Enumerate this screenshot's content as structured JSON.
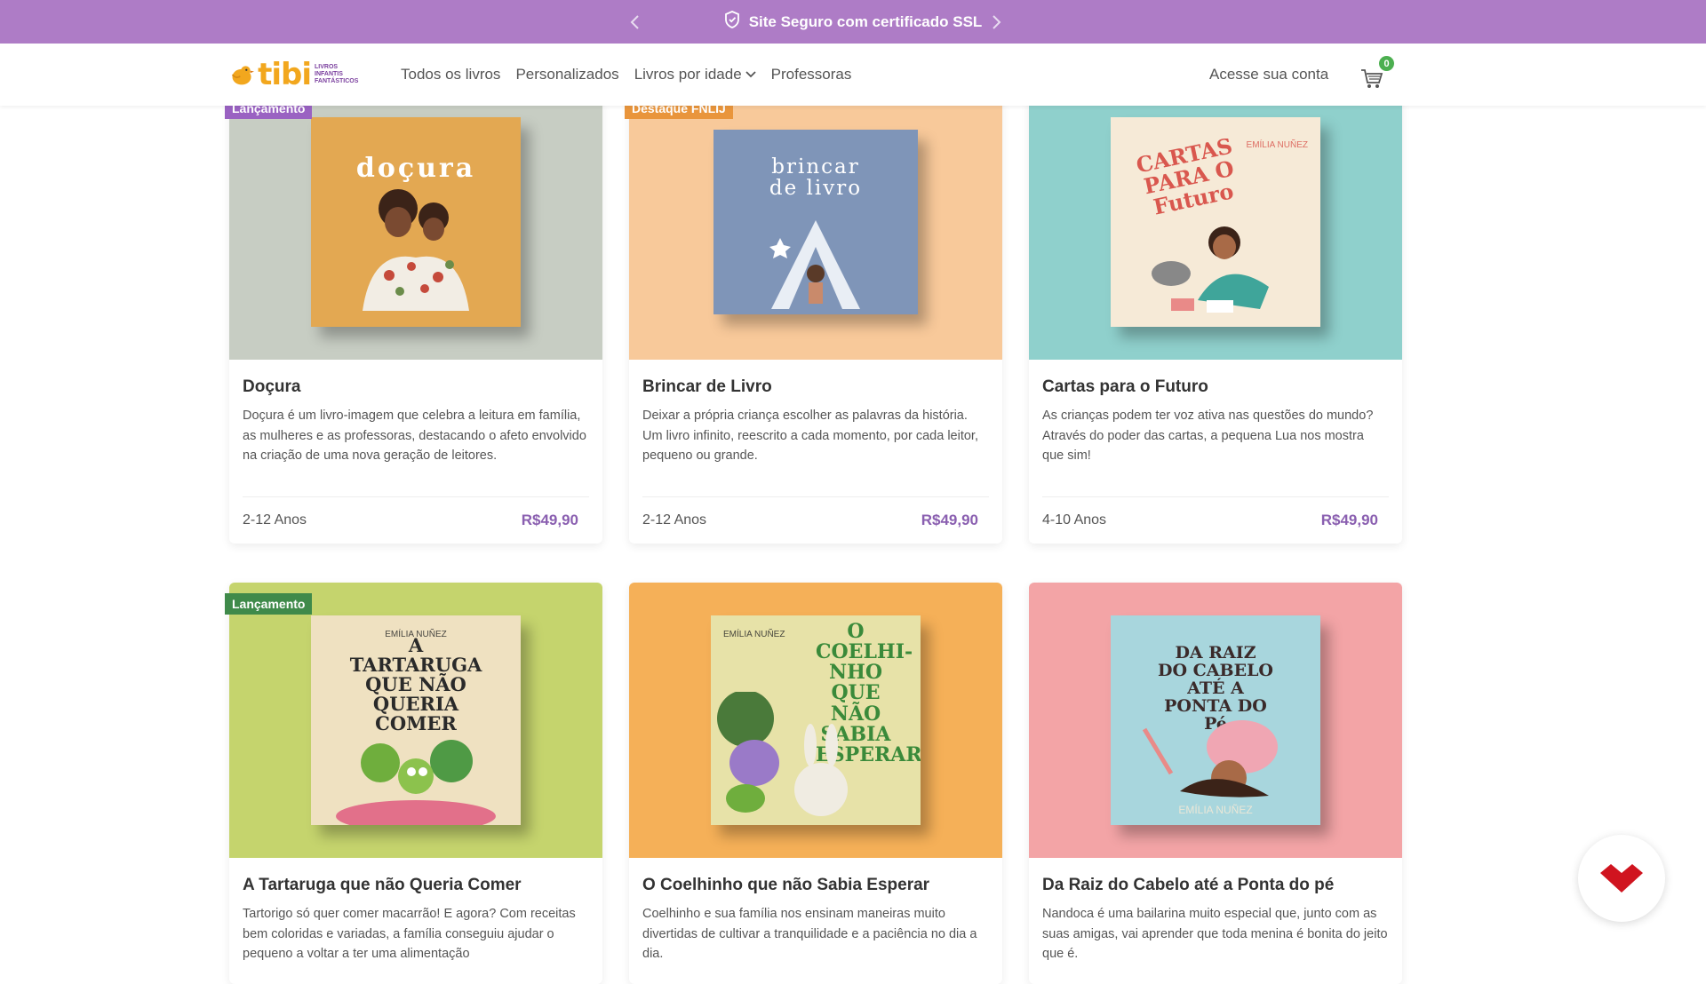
{
  "topbar": {
    "message": "Site Seguro com certificado SSL",
    "prev_icon": "chevron-left-icon",
    "next_icon": "chevron-right-icon",
    "shield_icon": "shield-icon",
    "background": "#ae7cc6"
  },
  "header": {
    "logo_text": "tibi",
    "logo_tagline": "LIVROS INFANTIS FANTÁSTICOS",
    "nav": [
      {
        "label": "Todos os livros"
      },
      {
        "label": "Personalizados"
      },
      {
        "label": "Livros por idade"
      },
      {
        "label": "Professoras"
      }
    ],
    "account_label": "Acesse sua conta",
    "cart_count": "0"
  },
  "colors": {
    "accent_purple": "#8a5fb0",
    "badge_purple": "#9a62c2",
    "badge_orange": "#e9953c",
    "badge_green": "#3f8a4a"
  },
  "products": [
    {
      "badge": "Lançamento",
      "title": "Doçura",
      "description": "Doçura é um livro-imagem que celebra a leitura em família, as mulheres e as professoras, destacando o afeto envolvido na criação de uma nova geração de leitores.",
      "age": "2-12 Anos",
      "price": "R$49,90",
      "cover_title": "doçura"
    },
    {
      "badge": "Destaque FNLIJ",
      "title": "Brincar de Livro",
      "description": "Deixar a própria criança escolher as palavras da história. Um livro infinito, reescrito a cada momento, por cada leitor, pequeno ou grande.",
      "age": "2-12 Anos",
      "price": "R$49,90",
      "cover_title": "brincar de livro"
    },
    {
      "badge": "",
      "title": "Cartas para o Futuro",
      "description": "As crianças podem ter voz ativa nas questões do mundo? Através do poder das cartas, a pequena Lua nos mostra que sim!",
      "age": "4-10 Anos",
      "price": "R$49,90",
      "cover_title": "CARTAS PARA O Futuro",
      "cover_author": "EMÍLIA NUÑEZ"
    },
    {
      "badge": "Lançamento",
      "title": "A Tartaruga que não Queria Comer",
      "description": "Tartorigo só quer comer macarrão! E agora? Com receitas bem coloridas e variadas, a família conseguiu ajudar o pequeno a voltar a ter uma alimentação",
      "cover_title": "A TARTARUGA QUE NÃO QUERIA COMER",
      "cover_author": "EMÍLIA NUÑEZ"
    },
    {
      "badge": "",
      "title": "O Coelhinho que não Sabia Esperar",
      "description": "Coelhinho e sua família nos ensinam maneiras muito divertidas de cultivar a tranquilidade e a paciência no dia a dia.",
      "cover_title": "O COELHI-NHO QUE NÃO SABIA ESPERAR",
      "cover_author": "EMÍLIA NUÑEZ"
    },
    {
      "badge": "",
      "title": "Da Raiz do Cabelo até a Ponta do pé",
      "description": "Nandoca é uma bailarina muito especial que, junto com as suas amigas, vai aprender que toda menina é bonita do jeito que é.",
      "cover_title": "DA RAIZ DO CABELO ATÉ A PONTA DO Pé",
      "cover_author": "EMÍLIA NUÑEZ"
    }
  ]
}
